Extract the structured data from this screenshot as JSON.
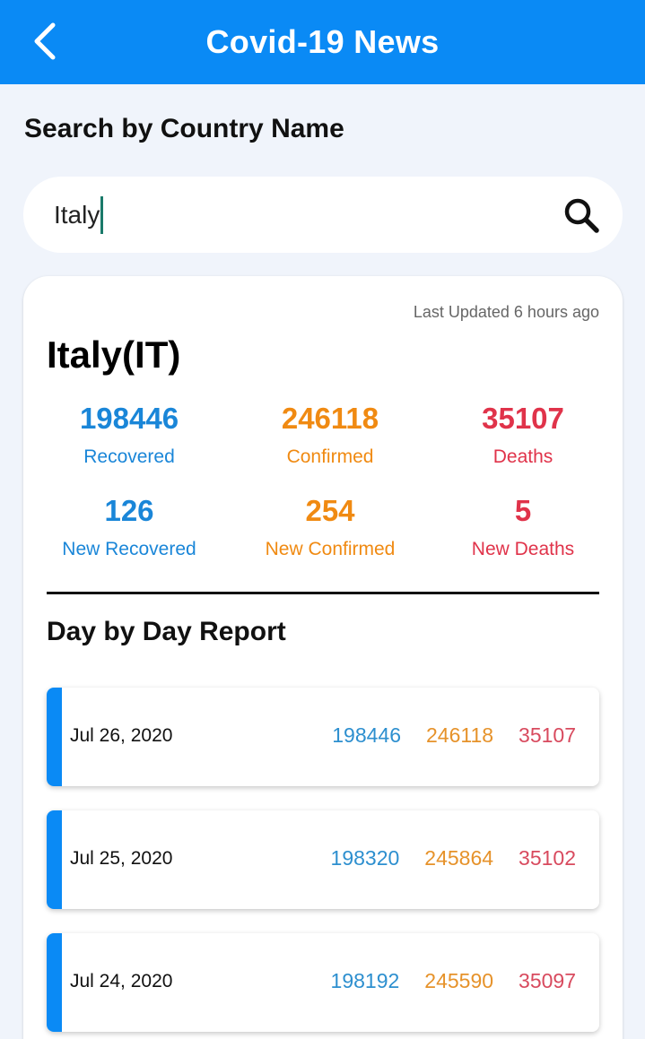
{
  "app_bar": {
    "title": "Covid-19 News",
    "back_icon": "chevron-left-icon"
  },
  "search": {
    "heading": "Search by Country Name",
    "value": "Italy",
    "icon": "search-icon"
  },
  "country_card": {
    "last_updated": "Last Updated 6 hours ago",
    "name": "Italy(IT)",
    "stats": {
      "recovered": {
        "value": "198446",
        "label": "Recovered"
      },
      "confirmed": {
        "value": "246118",
        "label": "Confirmed"
      },
      "deaths": {
        "value": "35107",
        "label": "Deaths"
      },
      "new_recovered": {
        "value": "126",
        "label": "New Recovered"
      },
      "new_confirmed": {
        "value": "254",
        "label": "New Confirmed"
      },
      "new_deaths": {
        "value": "5",
        "label": "New Deaths"
      }
    },
    "report_title": "Day by Day Report",
    "reports": [
      {
        "date": "Jul 26, 2020",
        "recovered": "198446",
        "confirmed": "246118",
        "deaths": "35107"
      },
      {
        "date": "Jul 25, 2020",
        "recovered": "198320",
        "confirmed": "245864",
        "deaths": "35102"
      },
      {
        "date": "Jul 24, 2020",
        "recovered": "198192",
        "confirmed": "245590",
        "deaths": "35097"
      }
    ]
  },
  "colors": {
    "primary": "#0a8af5",
    "recovered": "#1a86d8",
    "confirmed": "#f08a12",
    "deaths": "#e0334a"
  }
}
